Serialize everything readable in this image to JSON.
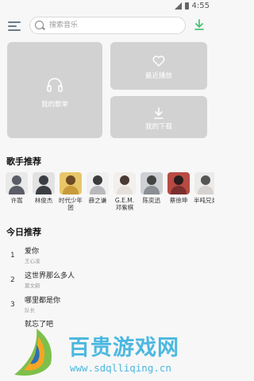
{
  "status_bar": {
    "time": "4:55"
  },
  "search": {
    "placeholder": "搜索音乐"
  },
  "tiles": {
    "my_playlist": "我的歌单",
    "recent_play": "最近播放",
    "my_downloads": "我的下载"
  },
  "singers_section": {
    "title": "歌手推荐",
    "items": [
      {
        "name": "许嵩",
        "color": "#5a5d66"
      },
      {
        "name": "林俊杰",
        "color": "#3a3d44"
      },
      {
        "name": "时代少年团",
        "color": "#c89a3a"
      },
      {
        "name": "薛之谦",
        "color": "#b9b9bd"
      },
      {
        "name": "G.E.M.邓紫棋",
        "color": "#e6e0dc"
      },
      {
        "name": "陈奕迅",
        "color": "#8b8e94"
      },
      {
        "name": "蔡徐坤",
        "color": "#7a2f2f"
      },
      {
        "name": "半吨兄弟",
        "color": "#d6d2cf"
      }
    ]
  },
  "today_section": {
    "title": "今日推荐",
    "songs": [
      {
        "num": "1",
        "title": "爱你",
        "artist": "王心凌"
      },
      {
        "num": "2",
        "title": "这世界那么多人",
        "artist": "莫文蔚"
      },
      {
        "num": "3",
        "title": "哪里都是你",
        "artist": "队长"
      },
      {
        "num": "",
        "title": "就忘了吧",
        "artist": ""
      }
    ]
  },
  "watermark": {
    "text": "百贵游戏网",
    "url": "www.sdqlliqing.cn"
  }
}
